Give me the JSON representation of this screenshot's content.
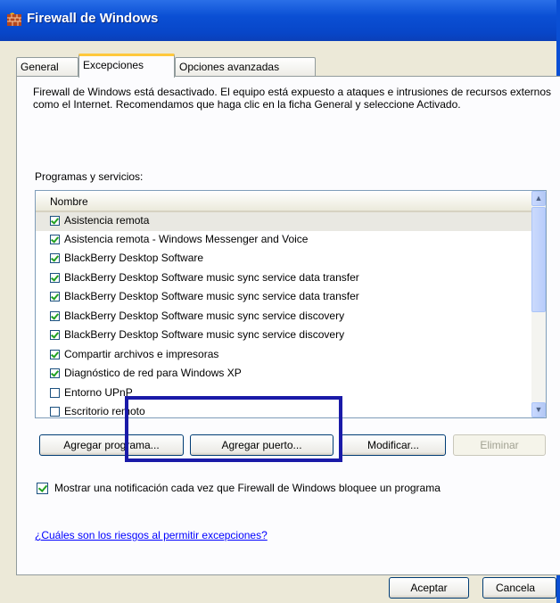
{
  "window": {
    "title": "Firewall de Windows",
    "icon": "firewall-brick-icon"
  },
  "tabs": [
    {
      "label": "General"
    },
    {
      "label": "Excepciones",
      "active": true
    },
    {
      "label": "Opciones avanzadas"
    }
  ],
  "exceptions": {
    "description": "Firewall de Windows está desactivado. El equipo está expuesto a ataques e intrusiones de recursos externos como el Internet. Recomendamos que haga clic en la ficha General y seleccione Activado.",
    "list_label": "Programas y servicios:",
    "column_header": "Nombre",
    "items": [
      {
        "label": "Asistencia remota",
        "checked": true,
        "selected": true
      },
      {
        "label": "Asistencia remota - Windows Messenger and Voice",
        "checked": true
      },
      {
        "label": "BlackBerry Desktop Software",
        "checked": true
      },
      {
        "label": "BlackBerry Desktop Software music sync service data transfer",
        "checked": true
      },
      {
        "label": "BlackBerry Desktop Software music sync service data transfer",
        "checked": true
      },
      {
        "label": "BlackBerry Desktop Software music sync service discovery",
        "checked": true
      },
      {
        "label": "BlackBerry Desktop Software music sync service discovery",
        "checked": true
      },
      {
        "label": "Compartir archivos e impresoras",
        "checked": true
      },
      {
        "label": "Diagnóstico de red para Windows XP",
        "checked": true
      },
      {
        "label": "Entorno UPnP",
        "checked": false
      },
      {
        "label": "Escritorio remoto",
        "checked": false
      }
    ],
    "buttons": {
      "add_program": "Agregar programa...",
      "add_port": "Agregar puerto...",
      "modify": "Modificar...",
      "delete": "Eliminar"
    },
    "notify_label": "Mostrar una notificación cada vez que Firewall de Windows bloquee un programa",
    "notify_checked": true,
    "risks_link": "¿Cuáles son los riesgos al permitir excepciones?"
  },
  "footer": {
    "ok": "Aceptar",
    "cancel": "Cancela"
  },
  "colors": {
    "titlebar": "#0a4fd4",
    "annotation": "#1a1aa8",
    "link": "#0000ff"
  }
}
